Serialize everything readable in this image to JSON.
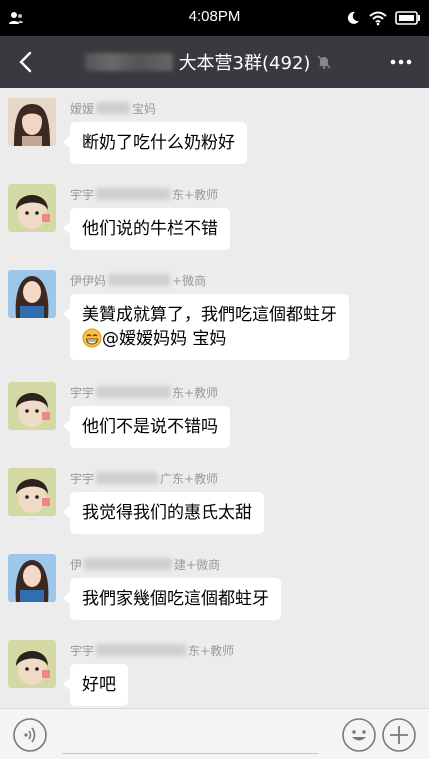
{
  "status_bar": {
    "time": "4:08PM"
  },
  "header": {
    "title": "大本营3群(492)"
  },
  "messages": [
    {
      "sender_visible_start": "嫒嫒",
      "sender_visible_end": "宝妈",
      "text": "断奶了吃什么奶粉好"
    },
    {
      "sender_visible_start": "宇宇",
      "sender_visible_end": "东+教师",
      "text": "他们说的牛栏不错"
    },
    {
      "sender_visible_start": "伊伊妈",
      "sender_visible_end": "+微商",
      "text_line1": "美贊成就算了，我們吃這個都蛀牙",
      "text_line2": "@嫒嫒妈妈 宝妈"
    },
    {
      "sender_visible_start": "宇宇",
      "sender_visible_end": "东+教师",
      "text": "他们不是说不错吗"
    },
    {
      "sender_visible_start": "宇宇",
      "sender_visible_end": "广东+教师",
      "text": "我觉得我们的惠氏太甜"
    },
    {
      "sender_visible_start": "伊",
      "sender_visible_end": "建+微商",
      "text": "我們家幾個吃這個都蛀牙"
    },
    {
      "sender_visible_start": "宇宇",
      "sender_visible_end": "东+教师",
      "text": "好吧"
    }
  ],
  "colors": {
    "header_bg": "#393a3f",
    "chat_bg": "#ececec",
    "bubble_bg": "#ffffff"
  },
  "icons": [
    "contacts-icon",
    "moon-icon",
    "wifi-icon",
    "battery-icon",
    "back-icon",
    "bell-off-icon",
    "more-icon",
    "grin-icon",
    "voice-icon",
    "emoji-icon",
    "plus-icon"
  ]
}
